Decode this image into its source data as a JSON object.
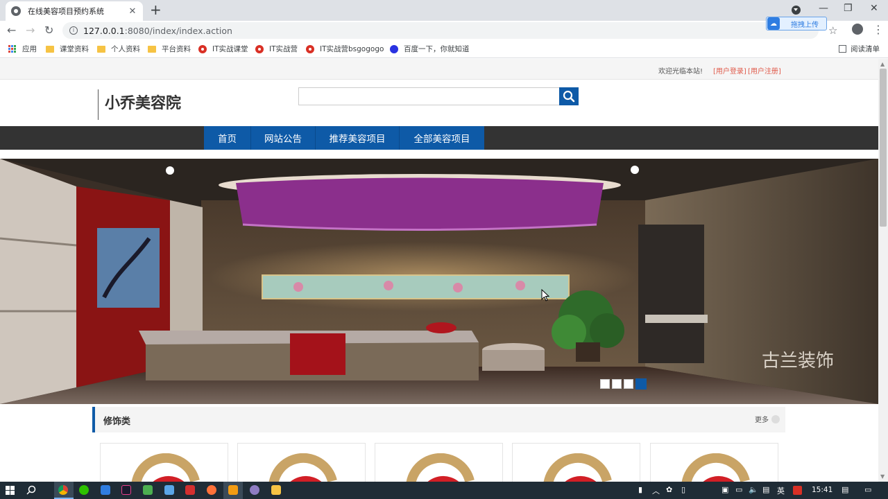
{
  "browser": {
    "tab_title": "在线美容项目预约系统",
    "url_host": "127.0.0.1",
    "url_rest": ":8080/index/index.action",
    "upload_label": "拖拽上传",
    "bookmarks": [
      "应用",
      "课堂资料",
      "个人资料",
      "平台资料",
      "IT实战课堂",
      "IT实战营",
      "IT实战营bsgogogo",
      "百度一下，你就知道"
    ],
    "reading_list": "阅读清单"
  },
  "site": {
    "welcome": "欢迎光临本站!",
    "login": "[用户登录]",
    "register": "[用户注册]",
    "brand": "小乔美容院",
    "search_placeholder": "",
    "nav": [
      "首页",
      "网站公告",
      "推荐美容项目",
      "全部美容项目"
    ],
    "banner_watermark": "古兰装饰",
    "slide_count": 4,
    "active_slide": 4,
    "section": {
      "title": "修饰类",
      "more": "更多"
    },
    "cards_count": 5
  },
  "taskbar": {
    "clock": "15:41",
    "ime": "英"
  },
  "colors": {
    "brand_blue": "#0e5aa7",
    "nav_dark": "#333333",
    "link_red": "#e05a4a"
  }
}
